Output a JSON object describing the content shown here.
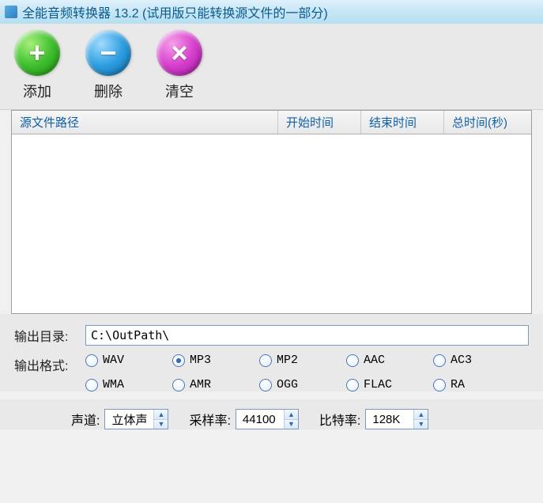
{
  "title": "全能音频转换器 13.2 (试用版只能转换源文件的一部分)",
  "toolbar": {
    "add": "添加",
    "delete": "删除",
    "clear": "清空"
  },
  "columns": {
    "path": "源文件路径",
    "start": "开始时间",
    "end": "结束时间",
    "total": "总时间(秒)"
  },
  "output": {
    "dir_label": "输出目录:",
    "dir_value": "C:\\OutPath\\",
    "format_label": "输出格式:",
    "formats": [
      "WAV",
      "MP3",
      "MP2",
      "AAC",
      "AC3",
      "WMA",
      "AMR",
      "OGG",
      "FLAC",
      "RA"
    ],
    "selected_format": "MP3"
  },
  "audio": {
    "channel_label": "声道:",
    "channel_value": "立体声",
    "samplerate_label": "采样率:",
    "samplerate_value": "44100",
    "bitrate_label": "比特率:",
    "bitrate_value": "128K"
  }
}
